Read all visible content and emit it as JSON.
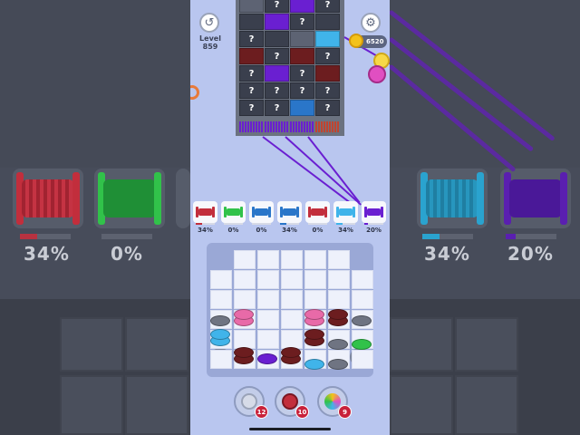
{
  "game": {
    "level_label": "Level 859",
    "coins": "6520",
    "undo_icon": "undo-icon",
    "settings_icon": "gear-icon",
    "colors": {
      "red": "#c22e3c",
      "green": "#31c24a",
      "blue": "#2a76c9",
      "light_blue": "#40b4ea",
      "purple": "#6a1fd1",
      "pink": "#e86aa8",
      "dark_red": "#6c1d1f",
      "gray": "#6f7482"
    }
  },
  "fabric": {
    "hidden_mark": "?"
  },
  "spools": [
    {
      "color": "red",
      "percent": "34%",
      "progress": 0.34
    },
    {
      "color": "green",
      "percent": "0%",
      "progress": 0
    },
    {
      "color": "blue",
      "percent": "0%",
      "progress": 0
    },
    {
      "color": "blue",
      "percent": "34%",
      "progress": 0.34
    },
    {
      "color": "red",
      "percent": "0%",
      "progress": 0
    },
    {
      "color": "light_blue",
      "percent": "34%",
      "progress": 0.34
    },
    {
      "color": "purple",
      "percent": "20%",
      "progress": 0.2
    }
  ],
  "side_panels": {
    "left_percent_1": "34%",
    "left_percent_2": "0%",
    "right_percent_1": "34%",
    "right_percent_2": "20%"
  },
  "board": {
    "blocker_1": "1",
    "blocker_2": "2"
  },
  "boosters": [
    {
      "name": "scissors-icon",
      "count": "12"
    },
    {
      "name": "thread-spool-icon",
      "count": "10"
    },
    {
      "name": "magic-ball-icon",
      "count": "9"
    }
  ]
}
